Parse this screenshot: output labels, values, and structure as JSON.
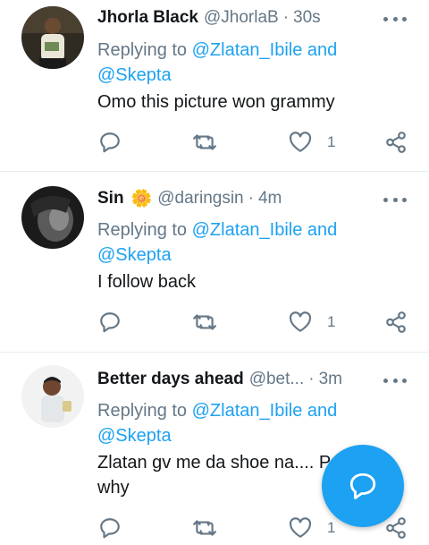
{
  "colors": {
    "accent": "#1da1f2",
    "muted": "#657786",
    "text": "#14171a",
    "divider": "#e6ecf0"
  },
  "tweets": [
    {
      "name": "Jhorla Black",
      "handle": "@JhorlaB",
      "dot": "·",
      "time": "30s",
      "replying_prefix": "Replying to",
      "replying_to_1": "@Zlatan_Ibile and",
      "replying_to_2": "@Skepta",
      "text": "Omo this picture won grammy",
      "likes": "1"
    },
    {
      "name": "Sin",
      "name_emoji": "🌼",
      "handle": "@daringsin",
      "dot": "·",
      "time": "4m",
      "replying_prefix": "Replying to",
      "replying_to_1": "@Zlatan_Ibile and",
      "replying_to_2": "@Skepta",
      "text": "I follow back",
      "likes": "1"
    },
    {
      "name": "Better days ahead",
      "handle": "@bet...",
      "dot": "·",
      "time": "3m",
      "replying_prefix": "Replying to",
      "replying_to_1": "@Zlatan_Ibile and",
      "replying_to_2": "@Skepta",
      "text_line1": "Zlatan gv me da shoe na.... P",
      "text_line2": "why",
      "likes": "1"
    }
  ],
  "icons": {
    "reply": "reply-icon",
    "retweet": "retweet-icon",
    "like": "heart-icon",
    "share": "share-icon",
    "more": "more-options-icon",
    "compose": "compose-reply-icon"
  }
}
